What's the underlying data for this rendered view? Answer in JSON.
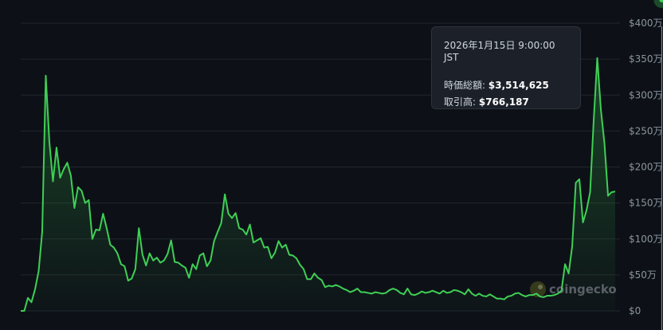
{
  "tooltip": {
    "date": "2026年1月15日 9:00:00 JST",
    "market_cap_label": "時価総額:",
    "market_cap_value": "$3,514,625",
    "volume_label": "取引高:",
    "volume_value": "$766,187"
  },
  "watermark": "coingecko",
  "colors": {
    "line": "#3fcf55",
    "grid": "#21262d",
    "crosshair": "#8b949e",
    "background": "#0d1117"
  },
  "chart_data": {
    "type": "area",
    "ylim": [
      0,
      4000000
    ],
    "y_ticks": [
      {
        "value": 0,
        "label": "$0"
      },
      {
        "value": 500000,
        "label": "$50万"
      },
      {
        "value": 1000000,
        "label": "$100万"
      },
      {
        "value": 1500000,
        "label": "$150万"
      },
      {
        "value": 2000000,
        "label": "$200万"
      },
      {
        "value": 2500000,
        "label": "$250万"
      },
      {
        "value": 3000000,
        "label": "$300万"
      },
      {
        "value": 3500000,
        "label": "$350万"
      },
      {
        "value": 4000000,
        "label": "$400万"
      }
    ],
    "highlight_index": 179,
    "values": [
      0,
      0,
      180000,
      120000,
      300000,
      550000,
      1100000,
      3270000,
      2350000,
      1800000,
      2270000,
      1850000,
      1970000,
      2060000,
      1880000,
      1430000,
      1720000,
      1670000,
      1500000,
      1540000,
      1000000,
      1130000,
      1120000,
      1350000,
      1150000,
      920000,
      880000,
      800000,
      650000,
      620000,
      420000,
      450000,
      580000,
      1150000,
      780000,
      630000,
      800000,
      700000,
      740000,
      670000,
      700000,
      790000,
      980000,
      680000,
      670000,
      630000,
      600000,
      460000,
      650000,
      580000,
      770000,
      800000,
      620000,
      700000,
      970000,
      1100000,
      1220000,
      1620000,
      1350000,
      1290000,
      1360000,
      1150000,
      1130000,
      1060000,
      1200000,
      950000,
      980000,
      1010000,
      880000,
      890000,
      730000,
      810000,
      970000,
      880000,
      920000,
      780000,
      770000,
      730000,
      640000,
      580000,
      440000,
      440000,
      520000,
      460000,
      430000,
      330000,
      350000,
      340000,
      360000,
      340000,
      310000,
      290000,
      260000,
      280000,
      310000,
      260000,
      260000,
      250000,
      240000,
      260000,
      250000,
      240000,
      250000,
      290000,
      310000,
      290000,
      250000,
      230000,
      310000,
      230000,
      220000,
      240000,
      270000,
      250000,
      260000,
      280000,
      260000,
      240000,
      280000,
      250000,
      260000,
      290000,
      280000,
      260000,
      230000,
      300000,
      240000,
      210000,
      240000,
      210000,
      200000,
      230000,
      200000,
      170000,
      170000,
      160000,
      200000,
      210000,
      240000,
      250000,
      220000,
      200000,
      220000,
      220000,
      240000,
      200000,
      190000,
      210000,
      210000,
      220000,
      240000,
      280000,
      650000,
      520000,
      900000,
      1780000,
      1830000,
      1230000,
      1400000,
      1650000,
      2650000,
      3514625,
      2800000,
      2330000,
      1600000,
      1650000,
      1660000
    ]
  }
}
